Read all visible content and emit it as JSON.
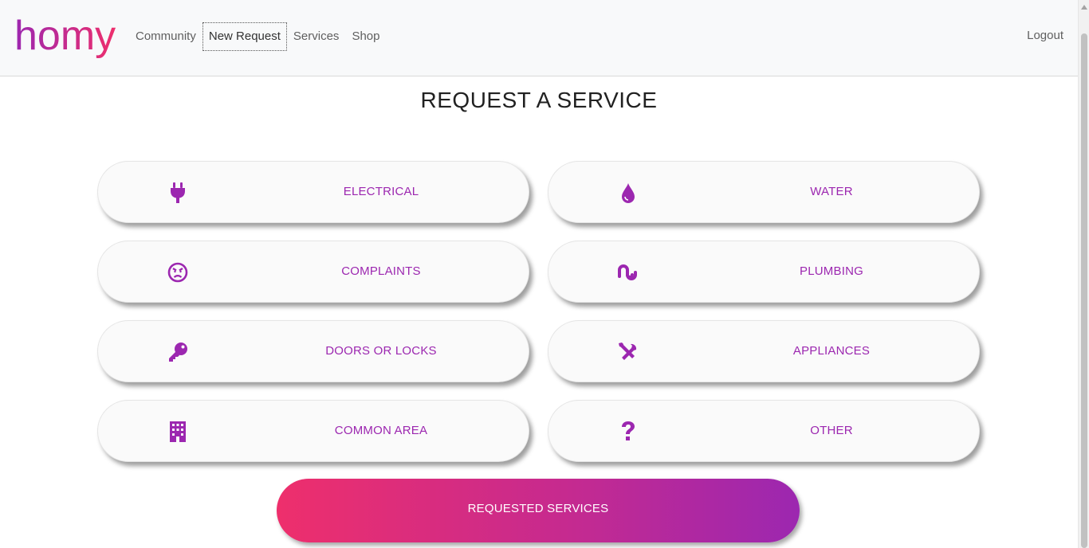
{
  "brand": {
    "logo_text": "homy"
  },
  "nav": {
    "links": [
      {
        "label": "Community"
      },
      {
        "label": "New Request"
      },
      {
        "label": "Services"
      },
      {
        "label": "Shop"
      }
    ],
    "logout_label": "Logout"
  },
  "page": {
    "title": "REQUEST A SERVICE"
  },
  "services": [
    {
      "label": "ELECTRICAL",
      "icon": "plug-icon"
    },
    {
      "label": "WATER",
      "icon": "water-drop-icon"
    },
    {
      "label": "COMPLAINTS",
      "icon": "angry-face-icon"
    },
    {
      "label": "PLUMBING",
      "icon": "stumbleupon-icon"
    },
    {
      "label": "DOORS OR LOCKS",
      "icon": "key-icon"
    },
    {
      "label": "APPLIANCES",
      "icon": "tools-icon"
    },
    {
      "label": "COMMON AREA",
      "icon": "building-icon"
    },
    {
      "label": "OTHER",
      "icon": "question-icon"
    }
  ],
  "cta": {
    "label": "REQUESTED SERVICES"
  },
  "colors": {
    "accent": "#9c27b0",
    "gradient_start": "#ee2f6c",
    "gradient_end": "#9c27b0",
    "navbar_bg": "#f8f9fa"
  }
}
